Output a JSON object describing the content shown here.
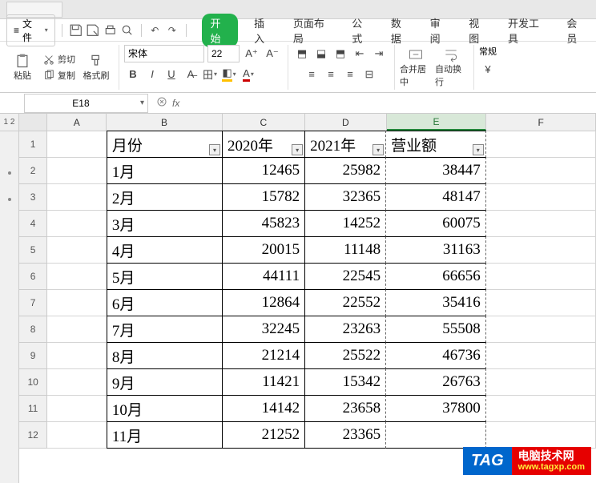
{
  "menu": {
    "file": "文件",
    "tabs": [
      "开始",
      "插入",
      "页面布局",
      "公式",
      "数据",
      "审阅",
      "视图",
      "开发工具",
      "会员"
    ],
    "active": 0
  },
  "clipboard": {
    "paste": "粘贴",
    "cut": "剪切",
    "copy": "复制",
    "format_painter": "格式刷"
  },
  "font": {
    "name": "宋体",
    "size": "22",
    "bold": "B",
    "italic": "I",
    "underline": "U",
    "strike": "A"
  },
  "align": {
    "merge": "合并居中",
    "wrap": "自动换行"
  },
  "number_group": "常规",
  "namebox": "E18",
  "fx": "fx",
  "columns": [
    "A",
    "B",
    "C",
    "D",
    "E",
    "F"
  ],
  "selected_col": "E",
  "headers": {
    "b": "月份",
    "c": "2020年",
    "d": "2021年",
    "e": "营业额"
  },
  "rows": [
    {
      "n": 1,
      "b": "月份",
      "c": "2020年",
      "d": "2021年",
      "e": "营业额",
      "header": true
    },
    {
      "n": 2,
      "b": "1月",
      "c": "12465",
      "d": "25982",
      "e": "38447"
    },
    {
      "n": 3,
      "b": "2月",
      "c": "15782",
      "d": "32365",
      "e": "48147"
    },
    {
      "n": 4,
      "b": "3月",
      "c": "45823",
      "d": "14252",
      "e": "60075"
    },
    {
      "n": 5,
      "b": "4月",
      "c": "20015",
      "d": "11148",
      "e": "31163"
    },
    {
      "n": 6,
      "b": "5月",
      "c": "44111",
      "d": "22545",
      "e": "66656"
    },
    {
      "n": 7,
      "b": "6月",
      "c": "12864",
      "d": "22552",
      "e": "35416"
    },
    {
      "n": 8,
      "b": "7月",
      "c": "32245",
      "d": "23263",
      "e": "55508"
    },
    {
      "n": 9,
      "b": "8月",
      "c": "21214",
      "d": "25522",
      "e": "46736"
    },
    {
      "n": 10,
      "b": "9月",
      "c": "11421",
      "d": "15342",
      "e": "26763"
    },
    {
      "n": 11,
      "b": "10月",
      "c": "14142",
      "d": "23658",
      "e": "37800"
    },
    {
      "n": 12,
      "b": "11月",
      "c": "21252",
      "d": "23365",
      "e": ""
    }
  ],
  "outline_levels": "1 2",
  "watermark": {
    "tag": "TAG",
    "text": "电脑技术网",
    "url": "www.tagxp.com"
  }
}
